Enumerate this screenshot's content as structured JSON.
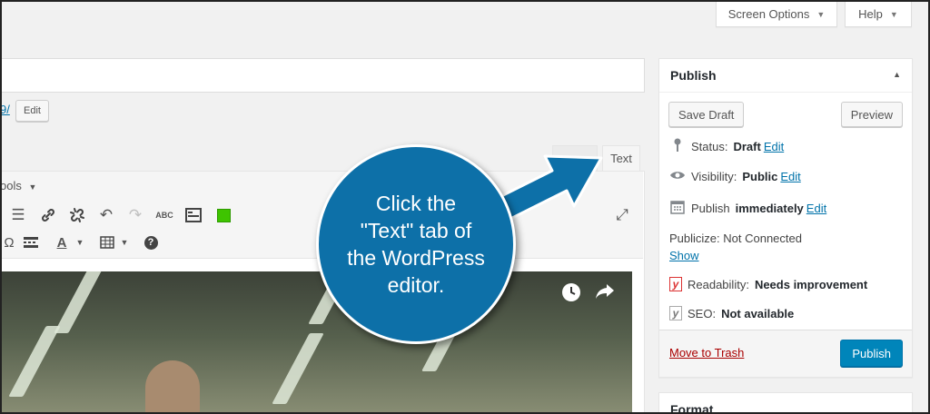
{
  "header": {
    "screen_options": "Screen Options",
    "help": "Help"
  },
  "permalink": {
    "url_tail": "9/",
    "edit_label": "Edit"
  },
  "editor": {
    "tabs": [
      {
        "label": "Text"
      }
    ],
    "tools_label": "ools"
  },
  "publish_box": {
    "title": "Publish",
    "save_draft": "Save Draft",
    "preview": "Preview",
    "status_label": "Status:",
    "status_value": "Draft",
    "visibility_label": "Visibility:",
    "visibility_value": "Public",
    "publish_label": "Publish",
    "publish_value": "immediately",
    "edit_link": "Edit",
    "publicize": "Publicize: Not Connected",
    "show_link": "Show",
    "readability_label": "Readability:",
    "readability_value": "Needs improvement",
    "seo_label": "SEO:",
    "seo_value": "Not available",
    "move_to_trash": "Move to Trash",
    "publish_button": "Publish"
  },
  "format_box": {
    "title": "Format"
  },
  "callout": {
    "line1": "Click the",
    "line2": "\"Text\" tab of",
    "line3": "the WordPress",
    "line4": "editor."
  },
  "colors": {
    "accent": "#0085ba",
    "callout": "#0d70a8",
    "link": "#0073aa",
    "trash": "#aa0000"
  }
}
